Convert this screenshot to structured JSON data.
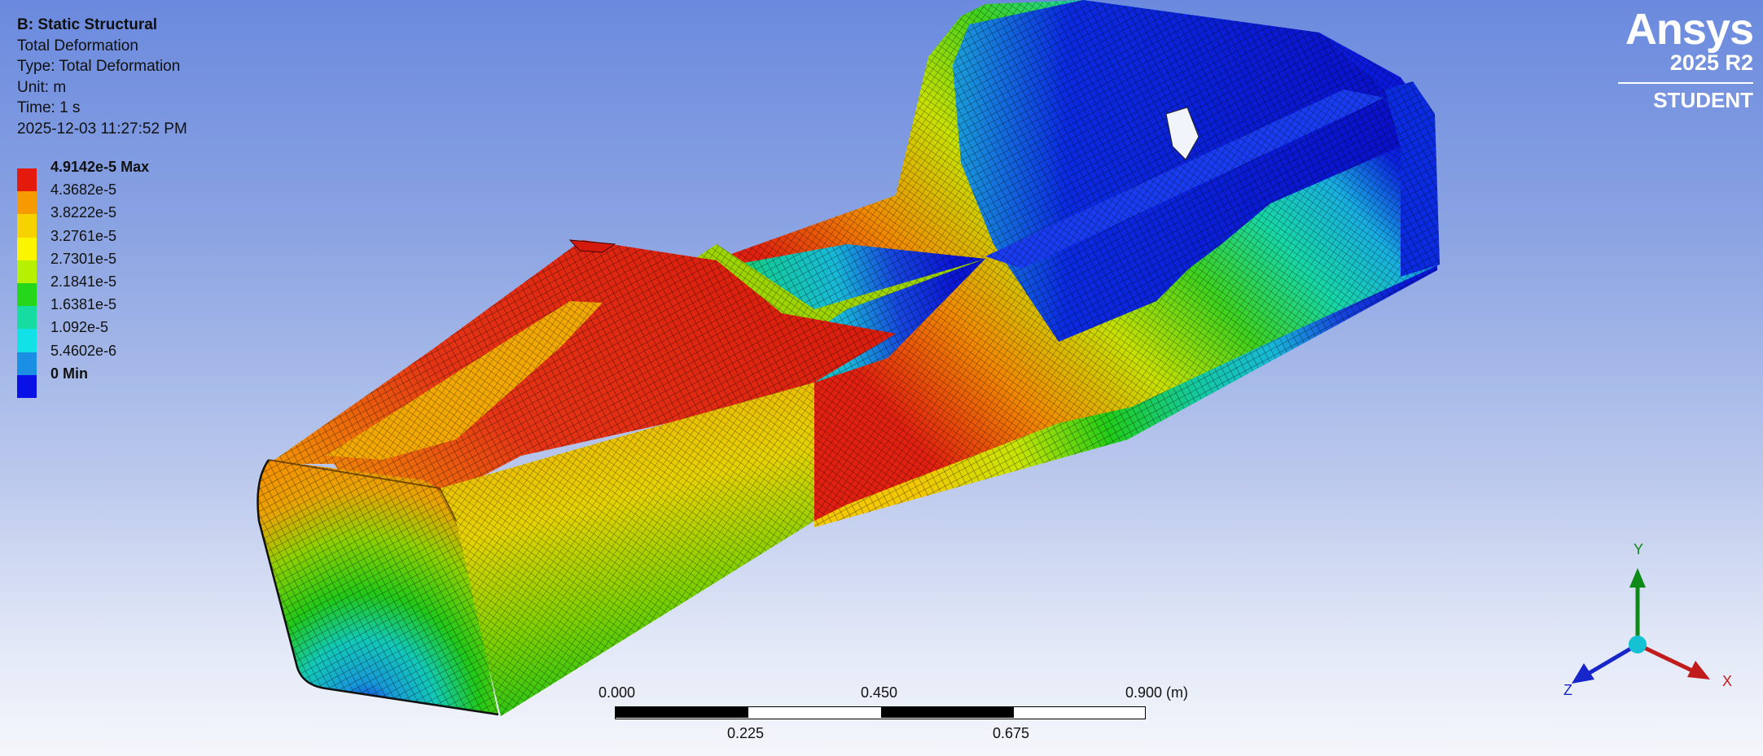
{
  "info": {
    "title": "B: Static Structural",
    "result": "Total Deformation",
    "type": "Type: Total Deformation",
    "unit": "Unit: m",
    "time": "Time: 1 s",
    "timestamp": "2025-12-03 11:27:52 PM"
  },
  "legend": {
    "entries": [
      {
        "label": "4.9142e-5 Max",
        "color": "#e41a0c"
      },
      {
        "label": "4.3682e-5",
        "color": "#f79a00"
      },
      {
        "label": "3.8222e-5",
        "color": "#f5d200"
      },
      {
        "label": "3.2761e-5",
        "color": "#fbf600"
      },
      {
        "label": "2.7301e-5",
        "color": "#b7f000"
      },
      {
        "label": "2.1841e-5",
        "color": "#26d61a"
      },
      {
        "label": "1.6381e-5",
        "color": "#17dca1"
      },
      {
        "label": "1.092e-5",
        "color": "#12e2e7"
      },
      {
        "label": "5.4602e-6",
        "color": "#1a8fe3"
      },
      {
        "label": "0 Min",
        "color": "#0a11e6"
      }
    ]
  },
  "logo": {
    "word": "Ansys",
    "version": "2025 R2",
    "edition": "STUDENT"
  },
  "scale_bar": {
    "top_labels": [
      "0.000",
      "0.450",
      "0.900 (m)"
    ],
    "bottom_labels": [
      "0.225",
      "0.675"
    ]
  },
  "triad": {
    "y": "Y",
    "x": "X",
    "z": "Z",
    "colors": {
      "x": "#c01c1c",
      "y": "#0e8a18",
      "z": "#1726c8",
      "origin": "#15c2d2"
    }
  }
}
